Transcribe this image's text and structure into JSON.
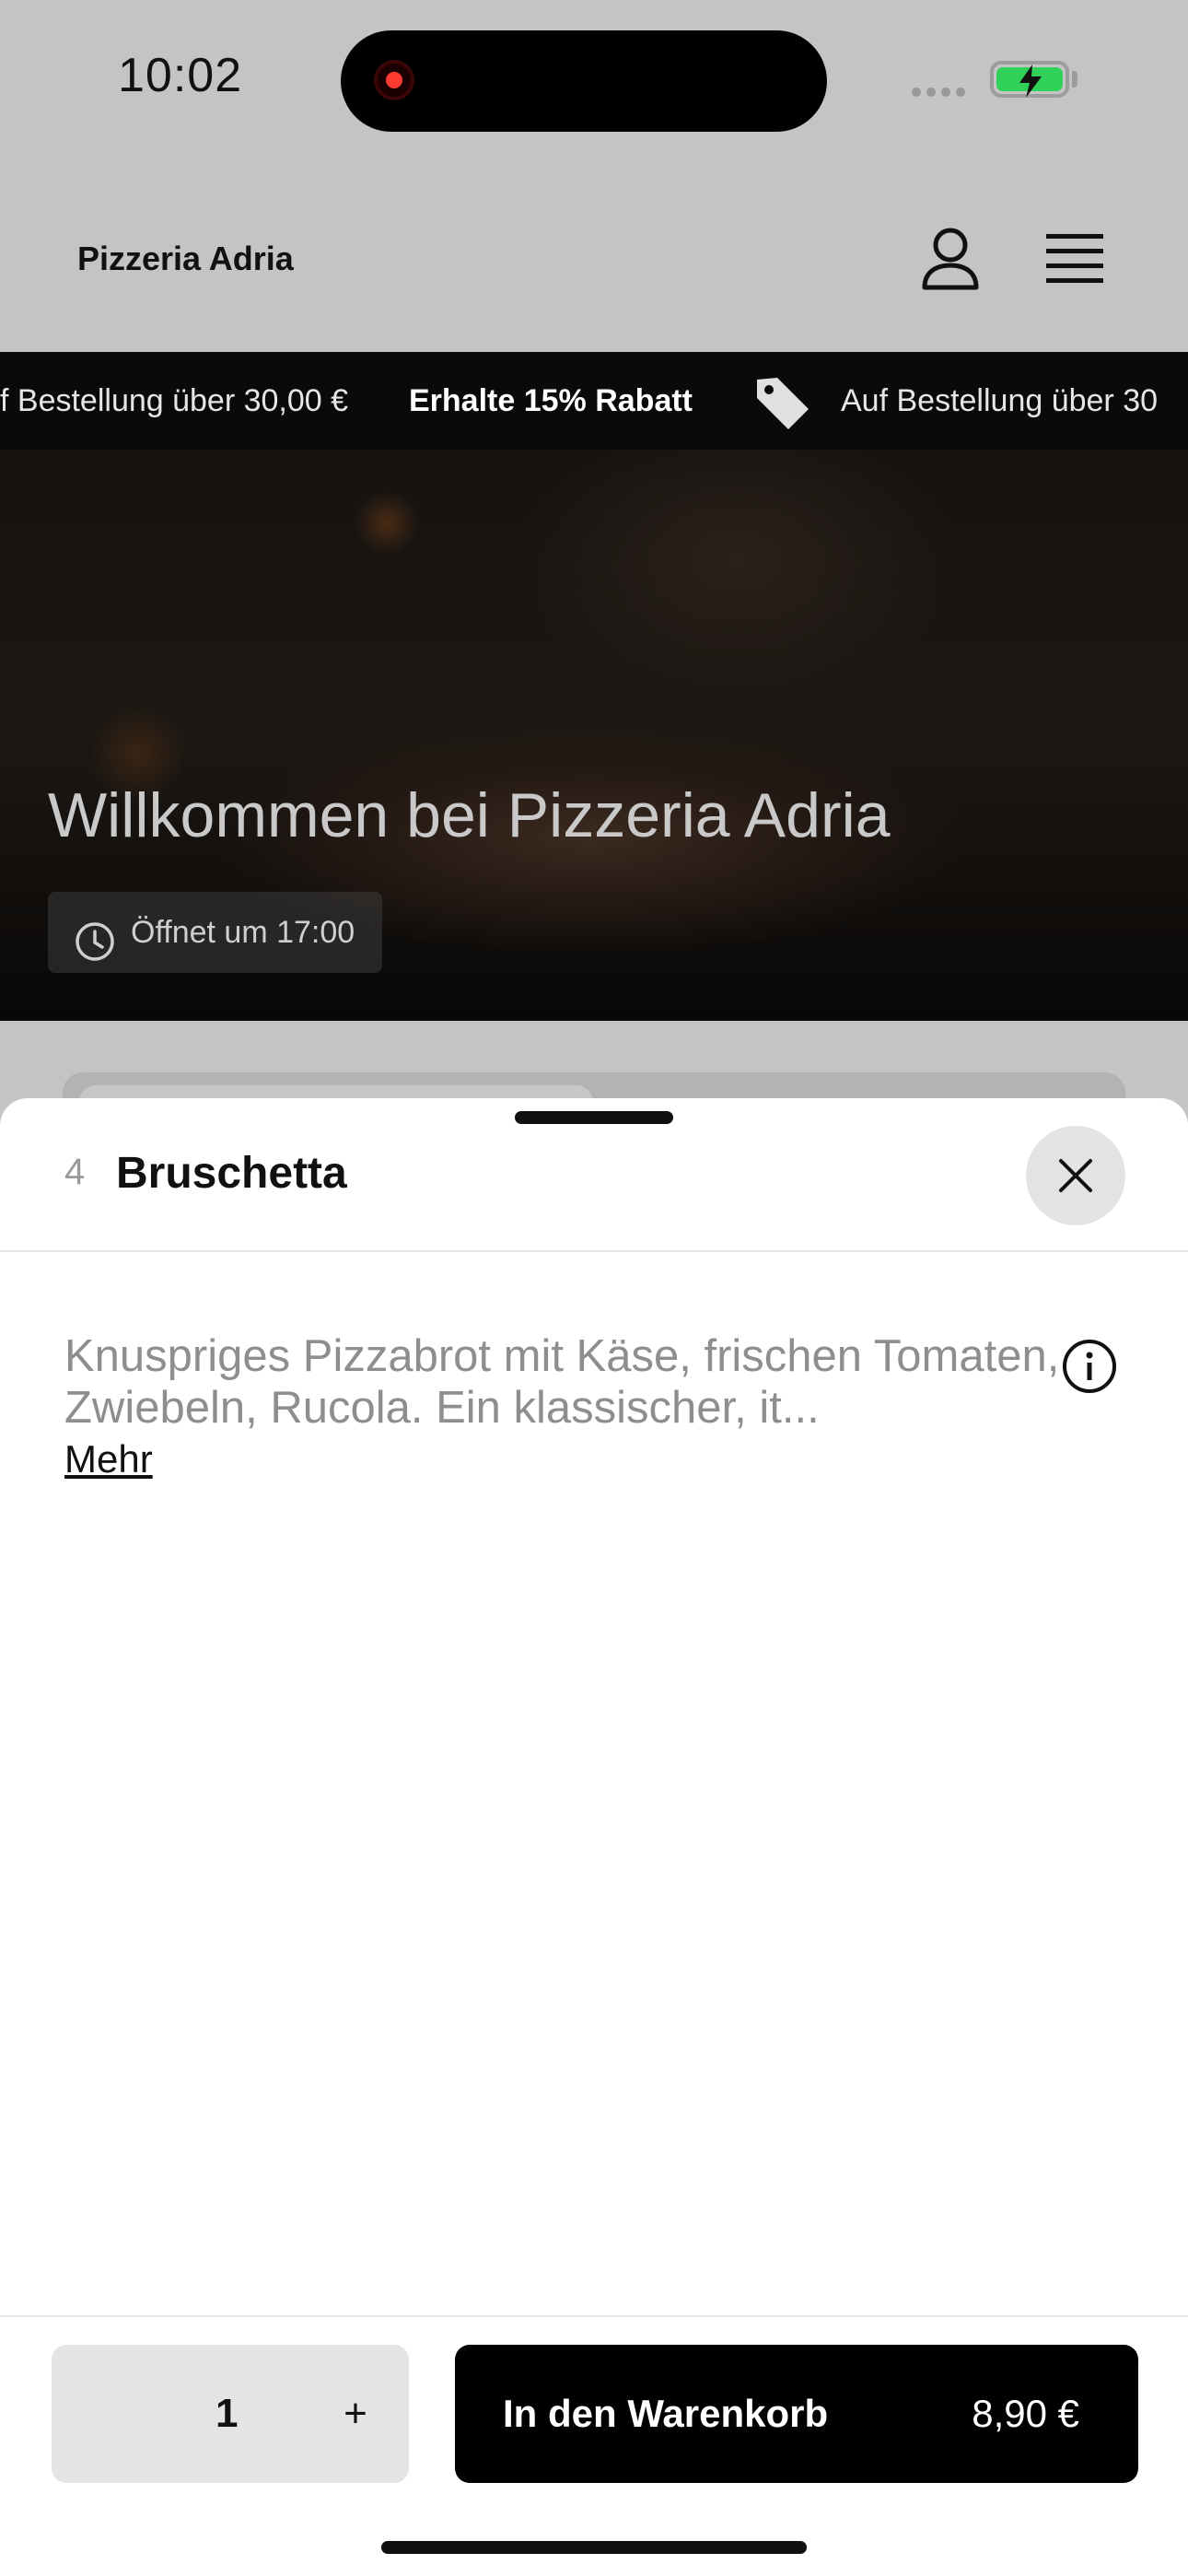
{
  "status_bar": {
    "time": "10:02"
  },
  "header": {
    "brand": "Pizzeria Adria"
  },
  "promo": {
    "text_partial_left": "f Bestellung über 30,00 €",
    "highlight": "Erhalte 15% Rabatt",
    "text_right": "Auf Bestellung über 30"
  },
  "hero": {
    "title": "Willkommen bei Pizzeria Adria",
    "hours": "Öffnet um 17:00"
  },
  "sheet": {
    "item_number": "4",
    "item_name": "Bruschetta",
    "description": "Knuspriges Pizzabrot mit Käse, frischen Tomaten, Zwiebeln, Rucola. Ein klassischer, it...",
    "more_label": "Mehr"
  },
  "footer": {
    "quantity": "1",
    "plus_label": "+",
    "add_to_cart_label": "In den Warenkorb",
    "price": "8,90 €"
  },
  "colors": {
    "primary_button": "#000000",
    "qty_background": "#e4e4e4",
    "overlay": "#c4c4c4"
  }
}
